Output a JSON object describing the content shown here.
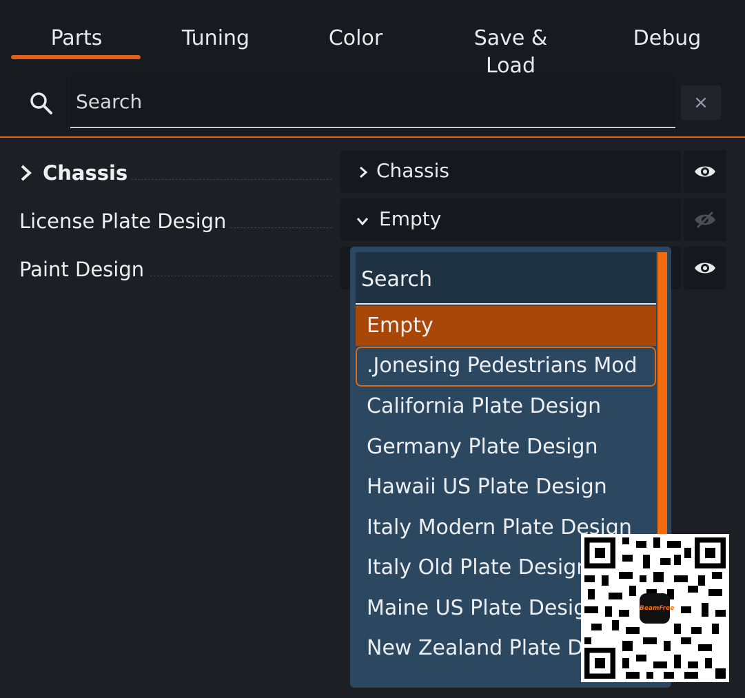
{
  "tabs": [
    {
      "label": "Parts",
      "active": true
    },
    {
      "label": "Tuning",
      "active": false
    },
    {
      "label": "Color",
      "active": false
    },
    {
      "label": "Save & Load",
      "active": false
    },
    {
      "label": "Debug",
      "active": false
    }
  ],
  "search": {
    "placeholder": "Search",
    "clear_label": "×"
  },
  "parts": [
    {
      "label": "Chassis",
      "value": "Chassis",
      "expanded": false,
      "visible": true
    },
    {
      "label": "License Plate Design",
      "value": "Empty",
      "expanded": true,
      "visible": false
    },
    {
      "label": "Paint Design",
      "value": "",
      "visible": true
    }
  ],
  "dropdown": {
    "search_placeholder": "Search",
    "options": [
      "Empty",
      ".Jonesing Pedestrians Mod",
      "California Plate Design",
      "Germany Plate Design",
      "Hawaii US Plate Design",
      "Italy Modern Plate Design",
      "Italy Old Plate Design",
      "Maine US Plate Design",
      "New Zealand Plate Design"
    ],
    "selected": "Empty",
    "focused": ".Jonesing Pedestrians Mod"
  },
  "overlay": {
    "qr_logo_text": "BeamFree"
  },
  "colors": {
    "accent": "#e06a12",
    "dropdown_bg": "#2b4860",
    "selected_bg": "#a94708"
  },
  "icons": [
    "search-icon",
    "close-icon",
    "chevron-right-icon",
    "chevron-down-icon",
    "eye-icon",
    "eye-off-icon"
  ]
}
